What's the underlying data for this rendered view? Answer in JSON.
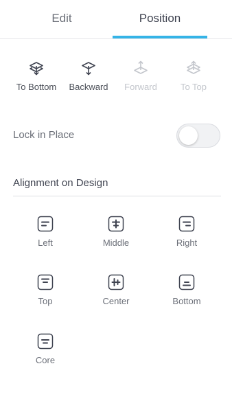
{
  "tabs": {
    "edit": "Edit",
    "position": "Position",
    "active": "Position"
  },
  "arrange": {
    "to_bottom": "To Bottom",
    "backward": "Backward",
    "forward": "Forward",
    "to_top": "To Top"
  },
  "lock": {
    "label": "Lock in Place",
    "enabled": false
  },
  "alignment": {
    "title": "Alignment on Design",
    "left": "Left",
    "middle": "Middle",
    "right": "Right",
    "top": "Top",
    "center": "Center",
    "bottom": "Bottom",
    "core": "Core"
  },
  "colors": {
    "accent": "#35b4e7",
    "icon": "#3f4350",
    "disabled": "#c3c6cc"
  }
}
